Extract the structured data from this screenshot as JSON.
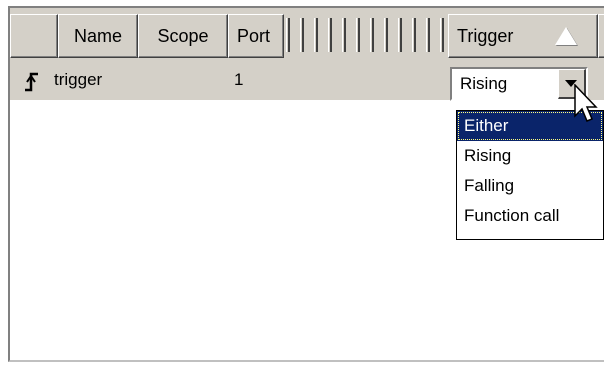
{
  "header": {
    "columns": [
      "Name",
      "Scope",
      "Port",
      "Trigger"
    ],
    "sort_indicator": "sort-ascending-triangle-icon"
  },
  "row": {
    "icon": "trigger-signal-icon",
    "name": "trigger",
    "port": "1",
    "trigger_value": "Rising"
  },
  "dropdown": {
    "options": [
      "Either",
      "Rising",
      "Falling",
      "Function call"
    ],
    "selected_index": 0
  },
  "colors": {
    "face": "#d4d0c8",
    "selection": "#0a246a"
  }
}
